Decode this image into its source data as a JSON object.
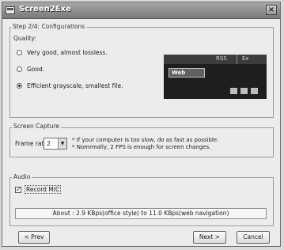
{
  "window": {
    "title": "Screen2Exe",
    "close_glyph": "×"
  },
  "step": {
    "label": "Step 2/4: Configurations"
  },
  "quality": {
    "title": "Quality:",
    "options": [
      {
        "label": "Very good, almost lossless.",
        "checked": false
      },
      {
        "label": "Good.",
        "checked": false
      },
      {
        "label": "Efficient grayscale, smallest file.",
        "checked": true
      }
    ],
    "preview": {
      "rss": "RSS",
      "ex": "Ex",
      "web": "Web"
    }
  },
  "screen_capture": {
    "title": "Screen Capture",
    "frame_rate_label": "Frame rate:",
    "frame_rate_value": "2",
    "dropdown_glyph": "▼",
    "note_line1": "* If your computer is too slow, do as fast as possible.",
    "note_line2": "* Nomrmally, 2 FPS is enough for screen changes."
  },
  "audio": {
    "title": "Audio",
    "record_mic_label": "Record MIC",
    "record_mic_checked": true,
    "check_glyph": "✓"
  },
  "about_text": "About : 2.9 KBps(office style) to 11.0 KBps(web navigation)",
  "buttons": {
    "prev": "< Prev",
    "next": "Next >",
    "cancel": "Cancel"
  }
}
